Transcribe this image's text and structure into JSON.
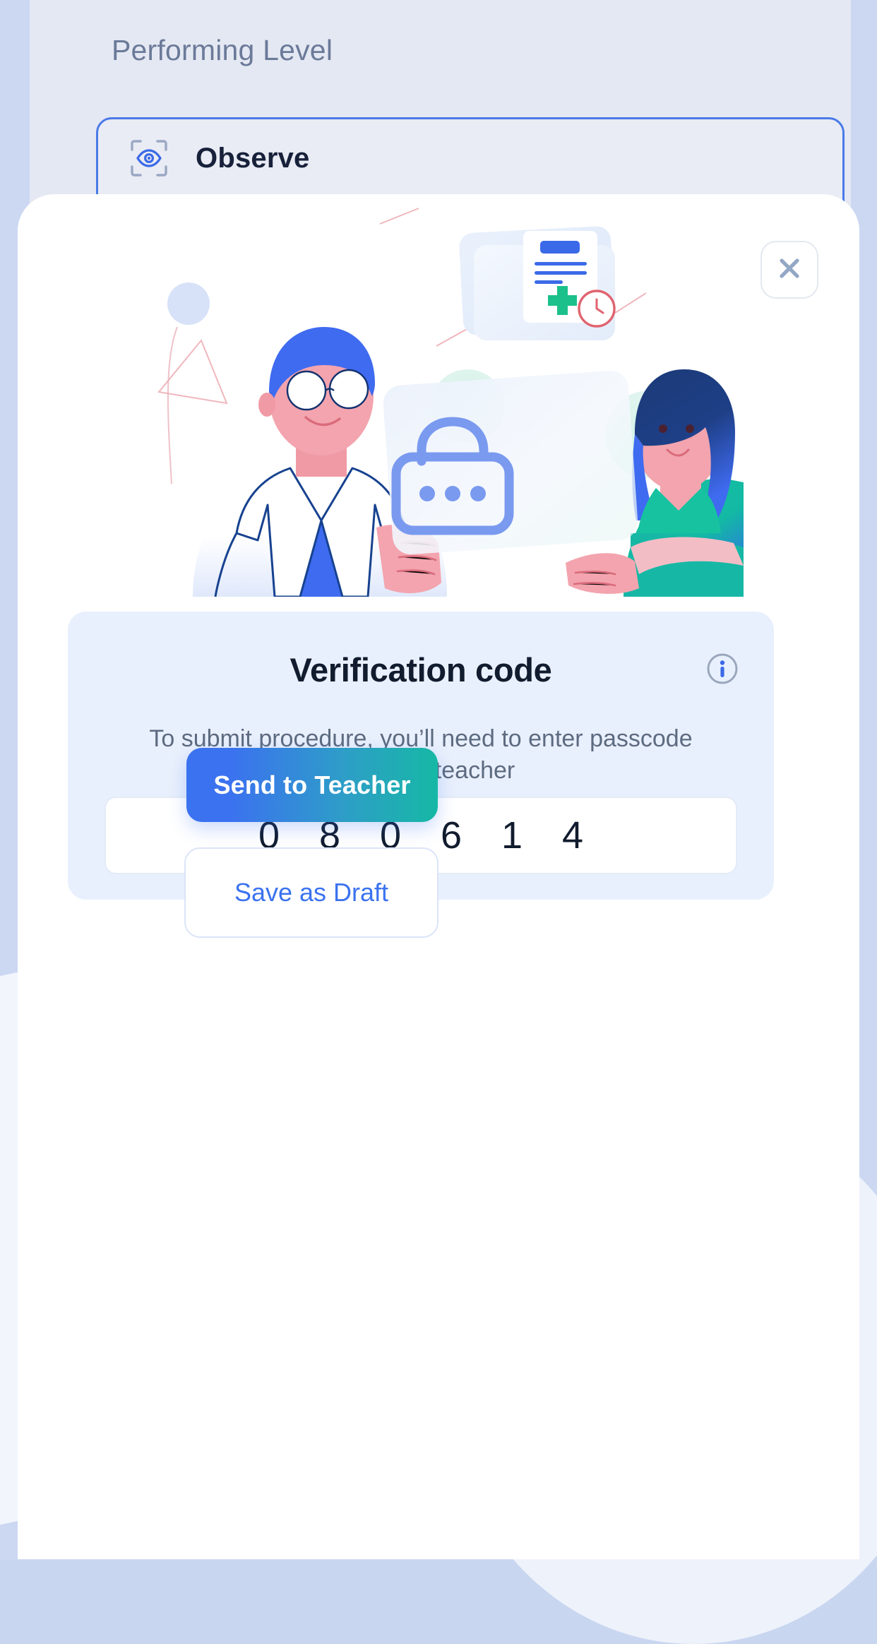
{
  "background": {
    "page_title": "Performing Level",
    "level_card": {
      "label": "Observe",
      "icon": "scan-eye-icon"
    }
  },
  "modal": {
    "close_icon": "close-icon",
    "illustration": {
      "name": "doctor-nurse-passcode-illustration",
      "elements": [
        "doctor-character",
        "nurse-character",
        "medical-record-card",
        "clock-badge",
        "unlocked-padlock-card"
      ]
    },
    "verification": {
      "title": "Verification code",
      "info_icon": "info-circle-icon",
      "description": "To submit procedure, you’ll need to enter passcode from your teacher",
      "code_digits": [
        "0",
        "8",
        "0",
        "6",
        "1",
        "4"
      ]
    },
    "actions": {
      "primary_label": "Send to Teacher",
      "secondary_label": "Save as Draft"
    }
  },
  "colors": {
    "brand_blue": "#3b72ef",
    "brand_teal": "#16b8a5",
    "panel_bg": "#e9f0fd",
    "app_bg": "#e4e8f2",
    "gutter": "#ccd8f2",
    "text_dark": "#111c2e",
    "text_muted": "#5d6b80",
    "title_muted": "#6b7a99"
  }
}
